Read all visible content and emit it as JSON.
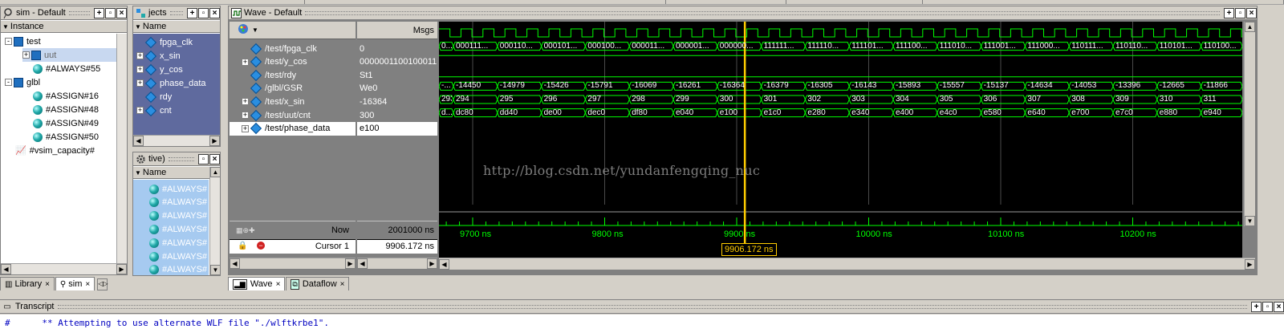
{
  "sim_panel": {
    "title": "sim - Default",
    "column": "Instance",
    "items": [
      {
        "label": "test",
        "level": 0,
        "icon": "module-icon",
        "expander": "-"
      },
      {
        "label": "uut",
        "level": 1,
        "icon": "module-icon",
        "expander": "+"
      },
      {
        "label": "#ALWAYS#55",
        "level": 1,
        "icon": "process-icon",
        "expander": ""
      },
      {
        "label": "glbl",
        "level": 0,
        "icon": "module-icon",
        "expander": "-"
      },
      {
        "label": "#ASSIGN#16",
        "level": 1,
        "icon": "process-icon",
        "expander": ""
      },
      {
        "label": "#ASSIGN#48",
        "level": 1,
        "icon": "process-icon",
        "expander": ""
      },
      {
        "label": "#ASSIGN#49",
        "level": 1,
        "icon": "process-icon",
        "expander": ""
      },
      {
        "label": "#ASSIGN#50",
        "level": 1,
        "icon": "process-icon",
        "expander": ""
      },
      {
        "label": "#vsim_capacity#",
        "level": 0,
        "icon": "capacity-icon",
        "expander": ""
      }
    ]
  },
  "objects_panel": {
    "title": "jects",
    "column": "Name",
    "items": [
      {
        "label": "fpga_clk",
        "expander": ""
      },
      {
        "label": "x_sin",
        "expander": "+"
      },
      {
        "label": "y_cos",
        "expander": "+"
      },
      {
        "label": "phase_data",
        "expander": "+"
      },
      {
        "label": "rdy",
        "expander": ""
      },
      {
        "label": "cnt",
        "expander": "+"
      }
    ]
  },
  "processes_panel": {
    "title": "tive)",
    "column": "Name",
    "items": [
      "#ALWAYS#",
      "#ALWAYS#",
      "#ALWAYS#",
      "#ALWAYS#",
      "#ALWAYS#",
      "#ALWAYS#",
      "#ALWAYS#"
    ]
  },
  "left_tabs": [
    {
      "label": "Library",
      "icon": "library-icon"
    },
    {
      "label": "sim",
      "icon": "sim-icon"
    }
  ],
  "wave": {
    "title": "Wave - Default",
    "msgs_label": "Msgs",
    "signals": [
      {
        "name": "/test/fpga_clk",
        "value": "0",
        "expander": ""
      },
      {
        "name": "/test/y_cos",
        "value": "0000001100100011",
        "expander": "+"
      },
      {
        "name": "/test/rdy",
        "value": "St1",
        "expander": ""
      },
      {
        "name": "/glbl/GSR",
        "value": "We0",
        "expander": ""
      },
      {
        "name": "/test/x_sin",
        "value": "-16364",
        "expander": "+"
      },
      {
        "name": "/test/uut/cnt",
        "value": "300",
        "expander": "+"
      },
      {
        "name": "/test/phase_data",
        "value": "e100",
        "expander": "+"
      }
    ],
    "now_label": "Now",
    "now_value": "2001000 ns",
    "cursor_label": "Cursor 1",
    "cursor_value": "9906.172 ns",
    "cursor_box": "9906.172 ns",
    "time_ticks": [
      "9700 ns",
      "9800 ns",
      "9900 ns",
      "10000 ns",
      "10100 ns",
      "10200 ns"
    ],
    "buses": {
      "y_cos": [
        "0...",
        "000111...",
        "000110...",
        "000101...",
        "000100...",
        "000011...",
        "000001...",
        "000000...",
        "111111...",
        "111110...",
        "111101...",
        "111100...",
        "111010...",
        "111001...",
        "111000...",
        "110111...",
        "110110...",
        "110101...",
        "110100..."
      ],
      "x_sin": [
        "-...",
        "-14450",
        "-14979",
        "-15426",
        "-15791",
        "-16069",
        "-16261",
        "-16364",
        "-16379",
        "-16305",
        "-16143",
        "-15893",
        "-15557",
        "-15137",
        "-14634",
        "-14053",
        "-13396",
        "-12665",
        "-11866"
      ],
      "cnt": [
        "293",
        "294",
        "295",
        "296",
        "297",
        "298",
        "299",
        "300",
        "301",
        "302",
        "303",
        "304",
        "305",
        "306",
        "307",
        "308",
        "309",
        "310",
        "311"
      ],
      "phase_data": [
        "d...",
        "dc80",
        "dd40",
        "de00",
        "dec0",
        "df80",
        "e040",
        "e100",
        "e1c0",
        "e280",
        "e340",
        "e400",
        "e4c0",
        "e580",
        "e640",
        "e700",
        "e7c0",
        "e880",
        "e940"
      ]
    },
    "watermark": "http://blog.csdn.net/yundanfengqing_nuc"
  },
  "bottom_tabs": [
    {
      "label": "Wave",
      "icon": "wave-icon"
    },
    {
      "label": "Dataflow",
      "icon": "dataflow-icon"
    }
  ],
  "transcript": {
    "title": "Transcript",
    "first_line": "#      ** Attempting to use alternate WLF file \"./wlftkrbe1\"."
  },
  "colors": {
    "chrome": "#d4d0c8",
    "selection": "#a6caf0",
    "signal_green": "#00ff00",
    "cursor_yellow": "#ffcc00",
    "objects_bg": "#5f6a9e"
  }
}
